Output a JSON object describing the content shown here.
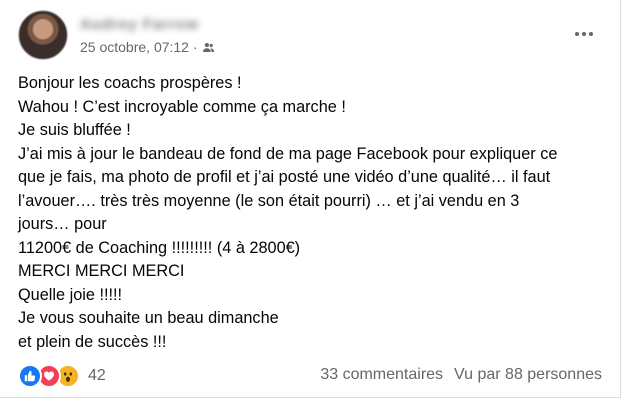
{
  "post": {
    "author_name": "Audrey Farrow",
    "timestamp": "25 octobre, 07:12",
    "separator": "·",
    "privacy_icon": "friends-icon",
    "body_lines": [
      "Bonjour les coachs prospères !",
      "Wahou ! C’est incroyable comme ça marche !",
      "Je suis bluffée !",
      "J’ai mis à jour le bandeau de fond de ma page Facebook pour expliquer ce",
      "que je fais, ma photo de profil et j’ai posté une vidéo d’une qualité… il faut",
      "l’avouer…. très très moyenne (le son était pourri) … et j’ai vendu en 3",
      "jours… pour",
      "11200€ de Coaching !!!!!!!!! (4 à 2800€)",
      "MERCI MERCI MERCI",
      "Quelle joie !!!!!",
      "Je vous souhaite un beau dimanche",
      "et plein de succès !!!"
    ]
  },
  "footer": {
    "reaction_icons": [
      "like-icon",
      "love-icon",
      "wow-icon"
    ],
    "reaction_count": "42",
    "comments": "33 commentaires",
    "views": "Vu par 88 personnes"
  },
  "colors": {
    "like": "#1877f2",
    "love": "#f33e58",
    "wow": "#f7b125",
    "secondary_text": "#65676b"
  }
}
